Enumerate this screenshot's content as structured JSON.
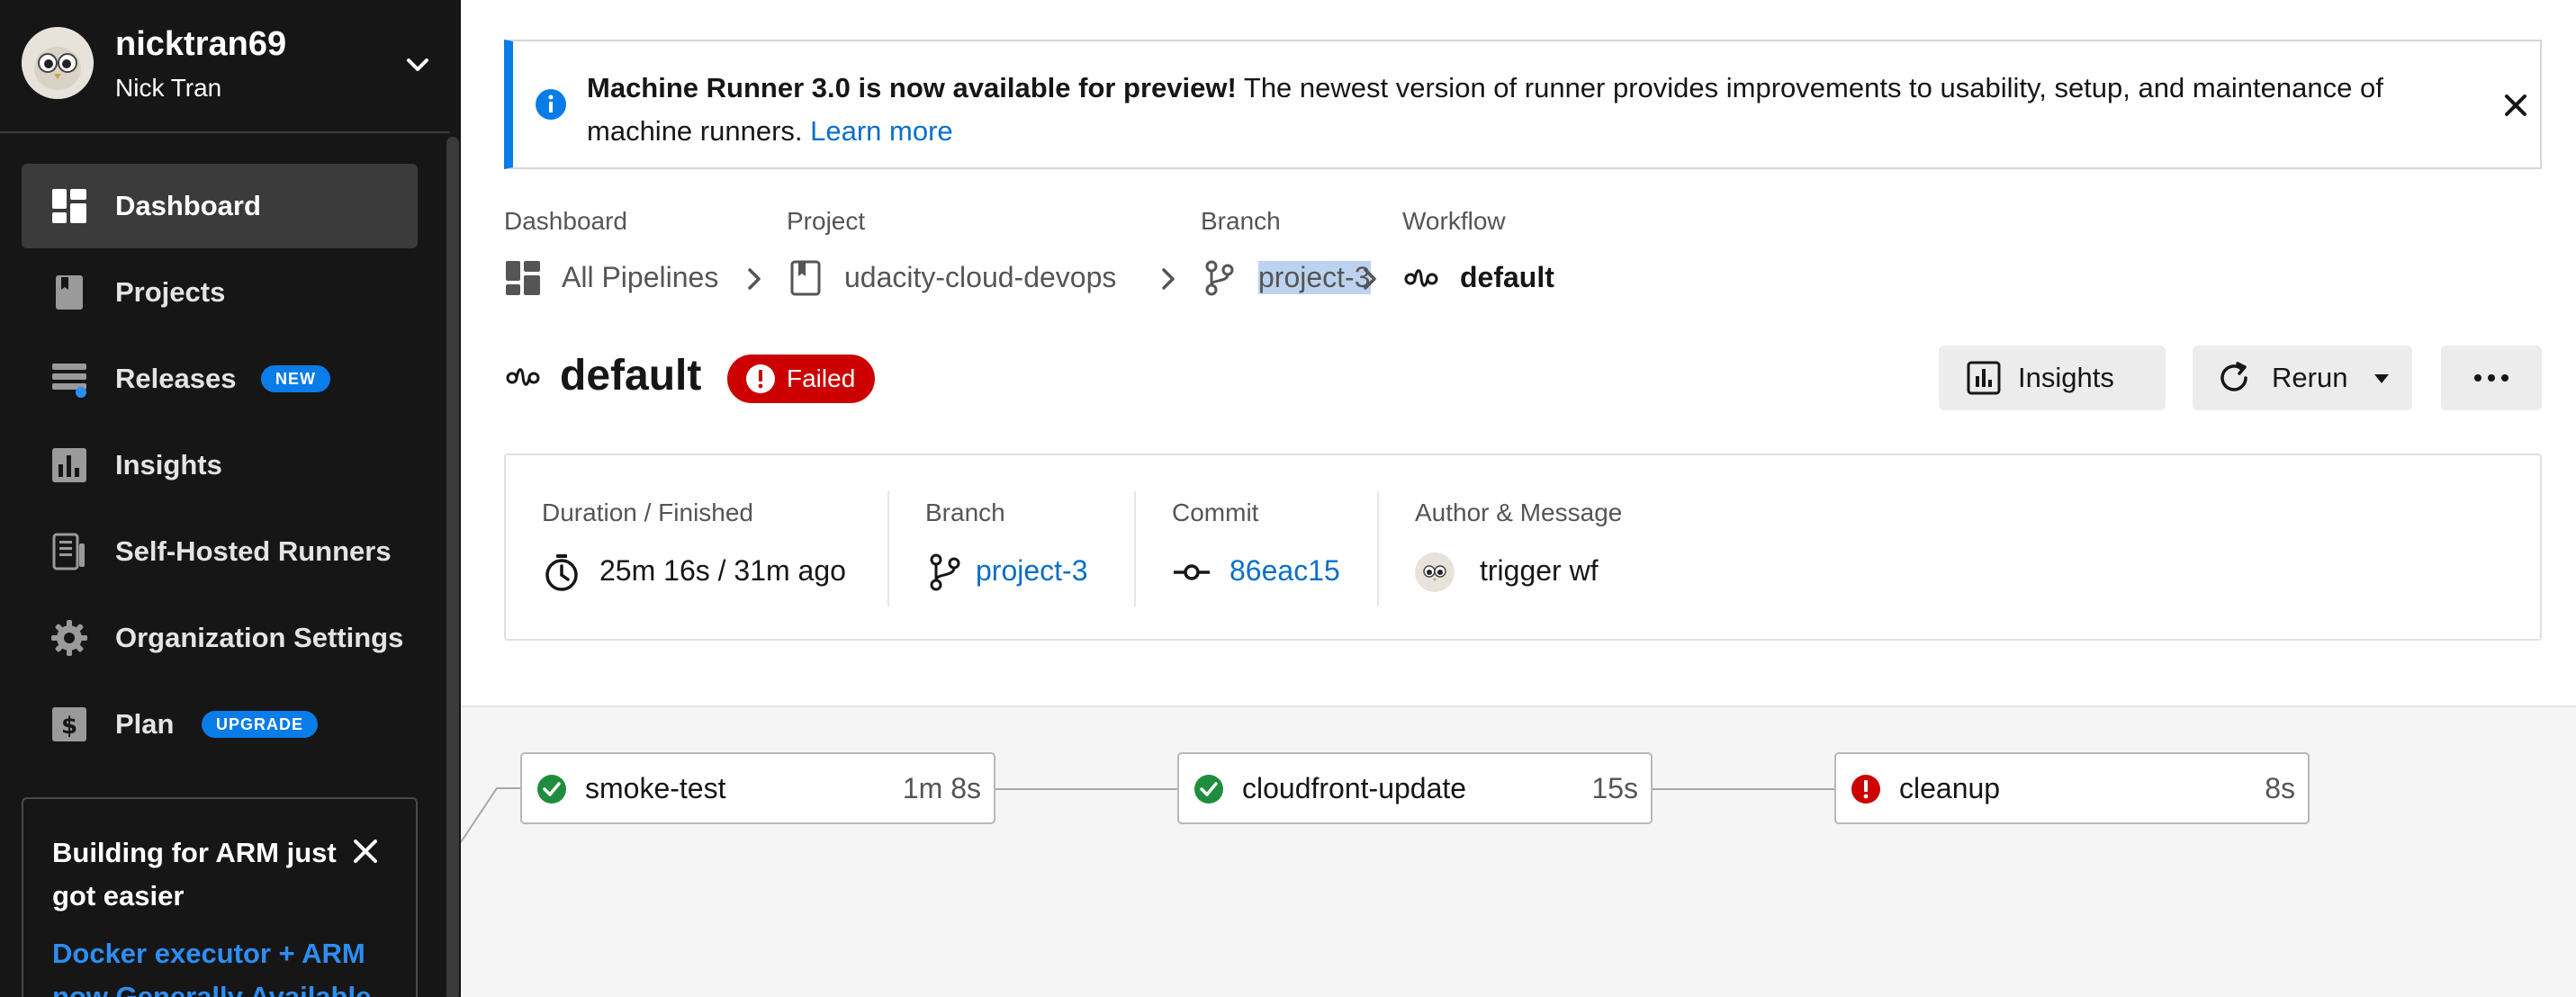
{
  "user": {
    "login": "nicktran69",
    "name": "Nick Tran"
  },
  "nav": [
    {
      "label": "Dashboard",
      "icon": "dashboard-icon",
      "active": true
    },
    {
      "label": "Projects",
      "icon": "bookmark-icon"
    },
    {
      "label": "Releases",
      "icon": "releases-icon",
      "badge": "NEW"
    },
    {
      "label": "Insights",
      "icon": "bar-chart-icon"
    },
    {
      "label": "Self-Hosted Runners",
      "icon": "runner-icon"
    },
    {
      "label": "Organization Settings",
      "icon": "gear-icon"
    },
    {
      "label": "Plan",
      "icon": "dollar-icon",
      "badge": "UPGRADE"
    }
  ],
  "promo": {
    "title": "Building for ARM just got easier",
    "link": "Docker executor + ARM now Generally Available"
  },
  "banner": {
    "bold": "Machine Runner 3.0 is now available for preview!",
    "text": " The newest version of runner provides improvements to usability, setup, and maintenance of machine runners. ",
    "link": "Learn more"
  },
  "breadcrumb": {
    "dashboard": {
      "caption": "Dashboard",
      "value": "All Pipelines"
    },
    "project": {
      "caption": "Project",
      "value": "udacity-cloud-devops"
    },
    "branch": {
      "caption": "Branch",
      "value": "project-3"
    },
    "workflow": {
      "caption": "Workflow",
      "value": "default"
    }
  },
  "workflow": {
    "name": "default",
    "status": "Failed",
    "status_color": "#cc0000",
    "insights_label": "Insights",
    "rerun_label": "Rerun"
  },
  "details": {
    "duration": {
      "caption": "Duration / Finished",
      "value": "25m 16s / 31m ago"
    },
    "branch": {
      "caption": "Branch",
      "value": "project-3"
    },
    "commit": {
      "caption": "Commit",
      "value": "86eac15"
    },
    "author": {
      "caption": "Author & Message",
      "value": "trigger wf"
    }
  },
  "jobs": [
    {
      "name": "smoke-test",
      "duration": "1m 8s",
      "status": "success"
    },
    {
      "name": "cloudfront-update",
      "duration": "15s",
      "status": "success"
    },
    {
      "name": "cleanup",
      "duration": "8s",
      "status": "failed"
    }
  ],
  "colors": {
    "accent": "#0a7ce8",
    "link": "#0a6fc7",
    "success": "#1e8e3e",
    "failed": "#cc0000",
    "sidebar": "#161616"
  }
}
